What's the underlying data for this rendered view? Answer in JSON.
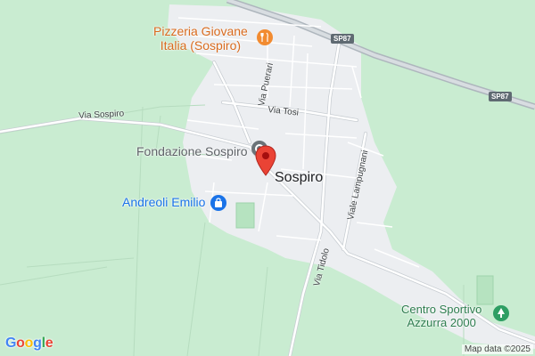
{
  "map": {
    "place_name": "Sospiro",
    "attribution": "Map data ©2025",
    "logo": [
      "G",
      "o",
      "o",
      "g",
      "l",
      "e"
    ],
    "logo_colors": [
      "#4285f4",
      "#ea4335",
      "#fbbc05",
      "#4285f4",
      "#34a853",
      "#ea4335"
    ],
    "colors": {
      "land": "#c9ecd1",
      "urban": "#eceef1",
      "road": "#ffffff",
      "highway": "#b8c0c6",
      "food_poi": "#f28b30",
      "shop_poi": "#1a73e8",
      "generic_poi": "#6b7378",
      "park_poi": "#2e9e63",
      "pin": "#ea4335"
    }
  },
  "pois": {
    "pizzeria": {
      "line1": "Pizzeria Giovane",
      "line2": "Italia (Sospiro)",
      "icon": "restaurant-icon"
    },
    "fondazione": {
      "label": "Fondazione Sospiro",
      "icon": "landmark-icon"
    },
    "andreoli": {
      "label": "Andreoli Emilio",
      "icon": "shopping-bag-icon"
    },
    "centro": {
      "line1": "Centro Sportivo",
      "line2": "Azzurra 2000",
      "icon": "park-icon"
    }
  },
  "roads": {
    "via_sospiro": "Via Sospiro",
    "via_puerari": "Via Puerari",
    "via_tosi": "Via Tosi",
    "viale_lampugnani": "Viale Lampugnani",
    "via_tidolo": "Via Tidolo",
    "sp87_a": "SP87",
    "sp87_b": "SP87"
  }
}
